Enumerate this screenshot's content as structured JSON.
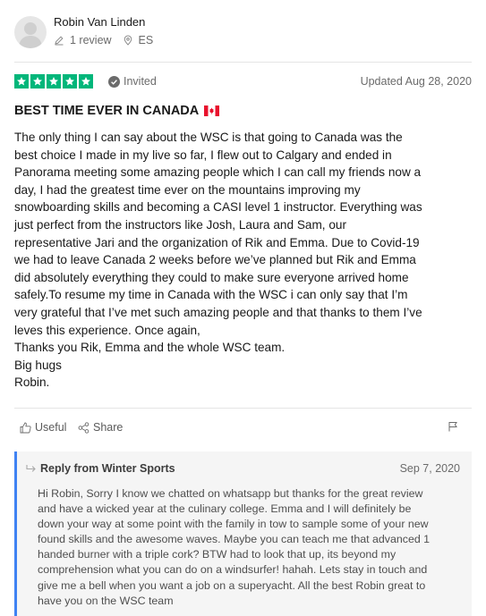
{
  "reviewer": {
    "name": "Robin Van Linden",
    "review_count": "1 review",
    "country": "ES"
  },
  "review": {
    "rating": 5,
    "max_rating": 5,
    "invited_label": "Invited",
    "updated": "Updated Aug 28, 2020",
    "title": "BEST TIME EVER IN CANADA",
    "body_lines": [
      "The only thing I can say about the WSC is that going to Canada was the",
      "best choice I made in my live so far, I flew out to Calgary and ended in",
      "Panorama meeting some amazing people which I can call my friends now a",
      "day, I had the greatest time ever on the mountains improving my",
      "snowboarding skills and becoming a CASI level 1 instructor. Everything was",
      "just perfect from the instructors like Josh, Laura and Sam, our",
      "representative Jari and the organization of Rik and Emma. Due to Covid-19",
      "we had to leave Canada 2 weeks before we’ve planned but Rik and Emma",
      "did absolutely everything they could to make sure everyone arrived home",
      "safely.To resume my time in Canada with the WSC i can only say that I’m",
      "very grateful that I’ve met such amazing people and that thanks to them I’ve",
      "leves this experience. Once again,",
      "Thanks you Rik, Emma and the whole WSC team.",
      "Big hugs",
      "Robin."
    ]
  },
  "actions": {
    "useful_label": "Useful",
    "share_label": "Share"
  },
  "reply": {
    "heading": "Reply from Winter Sports",
    "date": "Sep 7, 2020",
    "lines": [
      "Hi Robin, Sorry I know we chatted on whatsapp but thanks for the great review",
      "and have a wicked year at the culinary college. Emma and I will definitely be",
      "down your way at some point with the family in tow to sample some of your new",
      "found skills and the awesome waves. Maybe you can teach me that advanced 1",
      "handed burner with a triple cork? BTW had to look that up, its beyond my",
      "comprehension what you can do on a windsurfer! hahah. Lets stay in touch and",
      "give me a bell when you want a job on a superyacht. All the best Robin great to",
      "have you on the WSC team"
    ]
  },
  "colors": {
    "star_green": "#00b67a",
    "reply_accent": "#3f82f3",
    "reply_bg": "#f5f5f5"
  },
  "icons": {
    "avatar": "person-silhouette-icon",
    "reviews": "pencil-icon",
    "location": "location-pin-icon",
    "invited": "check-circle-icon",
    "flag": "canada-flag-icon",
    "useful": "thumbs-up-icon",
    "share": "share-icon",
    "report": "report-flag-icon",
    "reply": "reply-arrow-icon"
  }
}
